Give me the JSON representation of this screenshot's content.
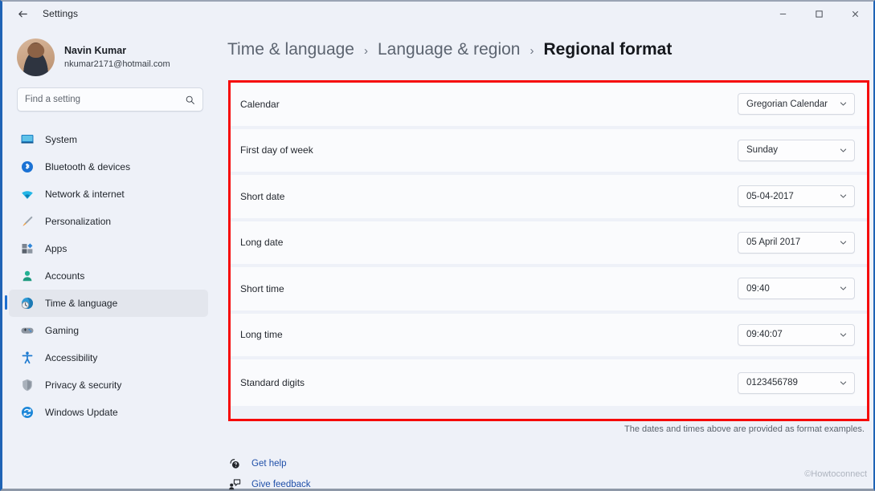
{
  "titlebar": {
    "back_icon": "back-arrow-icon",
    "app_title": "Settings",
    "minimize_label": "minimize-icon",
    "maximize_label": "maximize-icon",
    "close_label": "close-icon"
  },
  "sidebar": {
    "profile": {
      "name": "Navin Kumar",
      "email": "nkumar2171@hotmail.com",
      "avatar_alt": "user-avatar"
    },
    "search": {
      "placeholder": "Find a setting",
      "value": "",
      "icon": "search-icon"
    },
    "items": [
      {
        "label": "System",
        "icon": "monitor-icon",
        "selected": false
      },
      {
        "label": "Bluetooth & devices",
        "icon": "bluetooth-icon",
        "selected": false
      },
      {
        "label": "Network & internet",
        "icon": "wifi-icon",
        "selected": false
      },
      {
        "label": "Personalization",
        "icon": "paintbrush-icon",
        "selected": false
      },
      {
        "label": "Apps",
        "icon": "apps-grid-icon",
        "selected": false
      },
      {
        "label": "Accounts",
        "icon": "person-icon",
        "selected": false
      },
      {
        "label": "Time & language",
        "icon": "clock-globe-icon",
        "selected": true
      },
      {
        "label": "Gaming",
        "icon": "gamepad-icon",
        "selected": false
      },
      {
        "label": "Accessibility",
        "icon": "accessibility-icon",
        "selected": false
      },
      {
        "label": "Privacy & security",
        "icon": "shield-icon",
        "selected": false
      },
      {
        "label": "Windows Update",
        "icon": "update-refresh-icon",
        "selected": false
      }
    ]
  },
  "content": {
    "breadcrumb": [
      {
        "label": "Time & language",
        "current": false
      },
      {
        "label": "Language & region",
        "current": false
      },
      {
        "label": "Regional format",
        "current": true
      }
    ],
    "breadcrumb_separator": "›",
    "settings_rows": [
      {
        "label": "Calendar",
        "value": "Gregorian Calendar"
      },
      {
        "label": "First day of week",
        "value": "Sunday"
      },
      {
        "label": "Short date",
        "value": "05-04-2017"
      },
      {
        "label": "Long date",
        "value": "05 April 2017"
      },
      {
        "label": "Short time",
        "value": "09:40"
      },
      {
        "label": "Long time",
        "value": "09:40:07"
      },
      {
        "label": "Standard digits",
        "value": "0123456789"
      }
    ],
    "format_note": "The dates and times above are provided as format examples.",
    "footer_links": [
      {
        "label": "Get help",
        "icon": "help-question-icon"
      },
      {
        "label": "Give feedback",
        "icon": "feedback-icon"
      }
    ],
    "watermark": "©Howtoconnect"
  },
  "colors": {
    "accent": "#1d6fd0",
    "annotation": "#f60a0a",
    "window_chrome": "#eef1f8",
    "link": "#1f4fa8"
  }
}
